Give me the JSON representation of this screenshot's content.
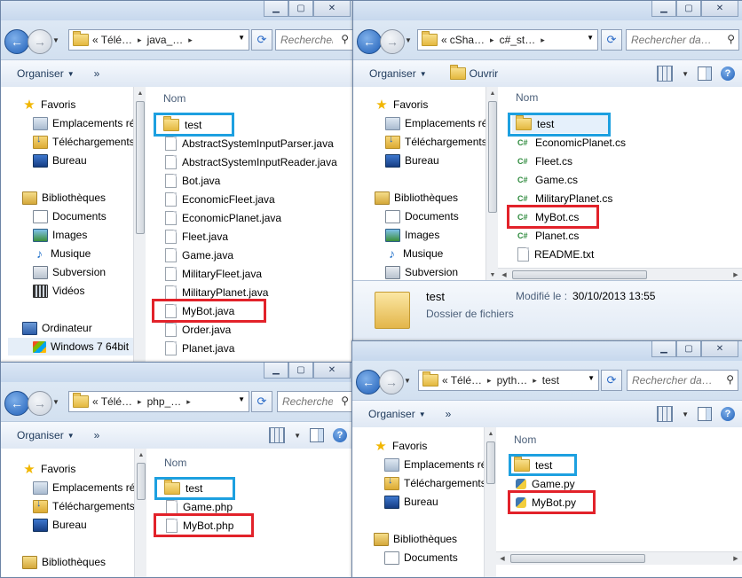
{
  "nav": {
    "organize": "Organiser",
    "more": "»",
    "open": "Ouvrir"
  },
  "column_header": "Nom",
  "search_placeholder": "Rechercher da…",
  "sidebar": {
    "favorites": "Favoris",
    "places": "Emplacements ré",
    "downloads": "Téléchargements",
    "desktop": "Bureau",
    "libraries": "Bibliothèques",
    "documents": "Documents",
    "images": "Images",
    "music": "Musique",
    "subversion": "Subversion",
    "videos": "Vidéos",
    "computer": "Ordinateur",
    "drive": "Windows 7 64bit"
  },
  "win_java": {
    "address": [
      "«",
      "Télé…",
      "java_…"
    ],
    "files": [
      "test",
      "AbstractSystemInputParser.java",
      "AbstractSystemInputReader.java",
      "Bot.java",
      "EconomicFleet.java",
      "EconomicPlanet.java",
      "Fleet.java",
      "Game.java",
      "MilitaryFleet.java",
      "MilitaryPlanet.java",
      "MyBot.java",
      "Order.java",
      "Planet.java"
    ]
  },
  "win_cs": {
    "address": [
      "«",
      "cSha…",
      "c#_st…"
    ],
    "files": [
      "test",
      "EconomicPlanet.cs",
      "Fleet.cs",
      "Game.cs",
      "MilitaryPlanet.cs",
      "MyBot.cs",
      "Planet.cs",
      "README.txt"
    ],
    "details": {
      "name": "test",
      "modified_label": "Modifié le :",
      "modified_value": "30/10/2013 13:55",
      "type": "Dossier de fichiers"
    }
  },
  "win_php": {
    "address": [
      "«",
      "Télé…",
      "php_…"
    ],
    "files": [
      "test",
      "Game.php",
      "MyBot.php"
    ]
  },
  "win_py": {
    "address": [
      "«",
      "Télé…",
      "pyth…",
      "test"
    ],
    "files": [
      "test",
      "Game.py",
      "MyBot.py"
    ]
  }
}
